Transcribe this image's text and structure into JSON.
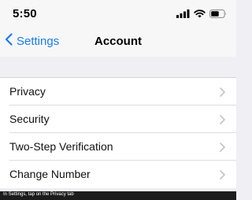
{
  "status_bar": {
    "time": "5:50",
    "icons": [
      "signal-icon",
      "wifi-icon",
      "battery-icon"
    ]
  },
  "nav": {
    "back_label": "Settings",
    "title": "Account",
    "accent_color": "#1a7cf5"
  },
  "list": {
    "items": [
      {
        "label": "Privacy"
      },
      {
        "label": "Security"
      },
      {
        "label": "Two-Step Verification"
      },
      {
        "label": "Change Number"
      }
    ]
  },
  "caption": {
    "text": "In Settings, tap on the Privacy tab"
  }
}
